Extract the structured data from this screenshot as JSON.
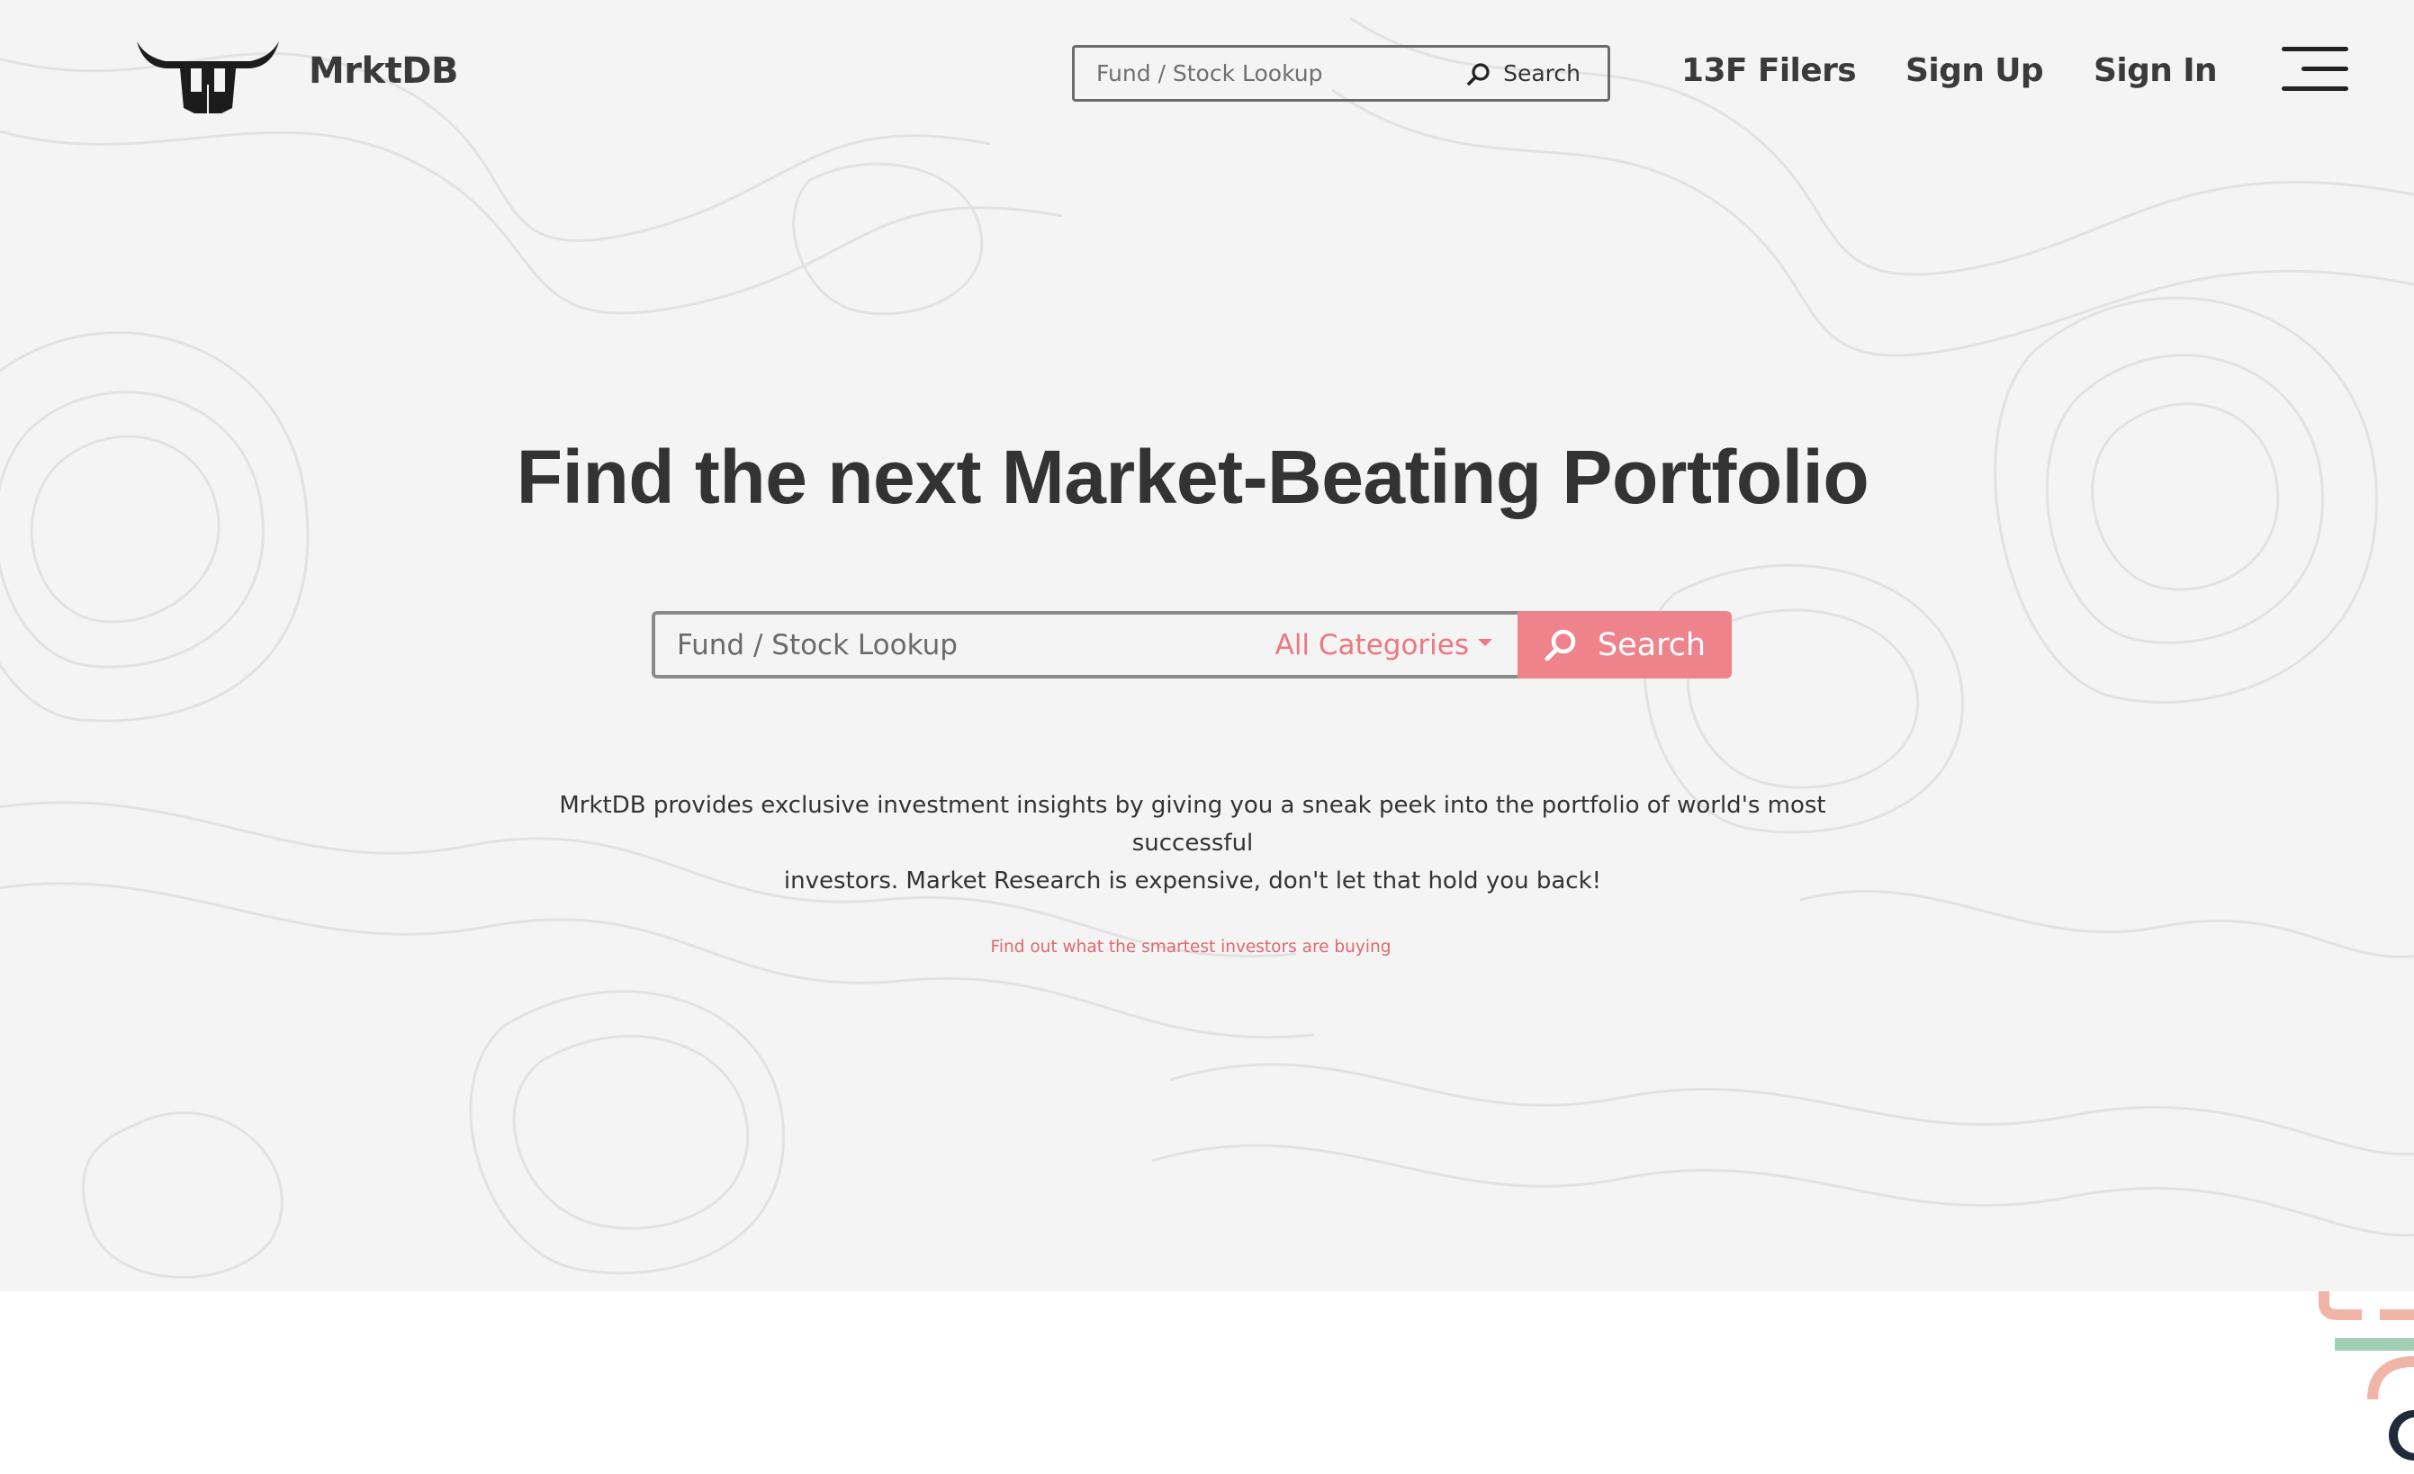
{
  "header": {
    "brand": "MrktDB",
    "search": {
      "placeholder": "Fund / Stock Lookup",
      "button_label": "Search"
    },
    "nav": [
      {
        "label": "13F Filers"
      },
      {
        "label": "Sign Up"
      },
      {
        "label": "Sign In"
      }
    ],
    "menu_icon": "hamburger-icon"
  },
  "hero": {
    "headline": "Find the next Market-Beating Portfolio",
    "search": {
      "placeholder": "Fund / Stock Lookup",
      "category_selected": "All Categories",
      "button_label": "Search"
    },
    "description_line1": "MrktDB provides exclusive investment insights by giving you a sneak peek into the portfolio of world's most successful",
    "description_line2": "investors. Market Research is expensive, don't let that hold you back!",
    "cta": "Find out what the smartest investors are buying"
  },
  "colors": {
    "accent": "#ef838c",
    "accent_text": "#ee7781",
    "hero_background": "#f4f4f4",
    "text": "#333333"
  }
}
